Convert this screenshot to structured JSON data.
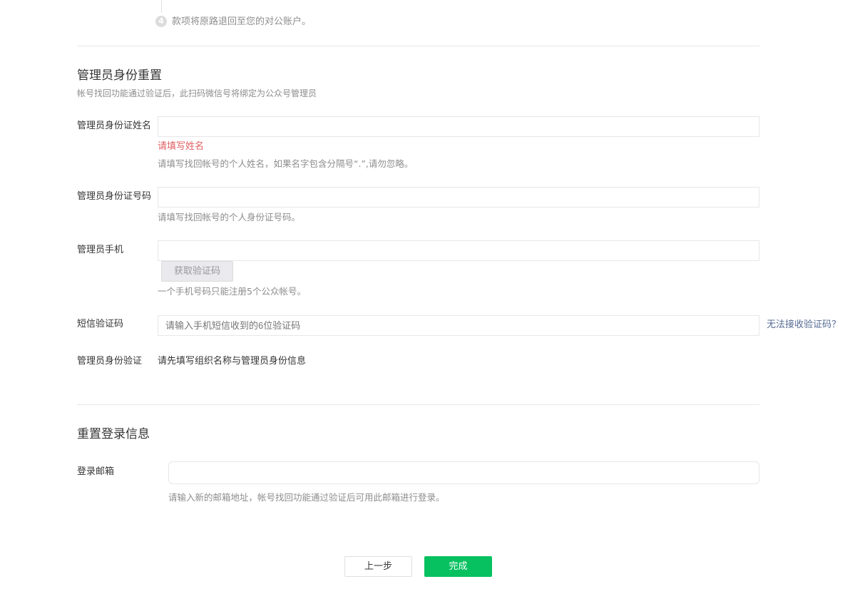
{
  "step": {
    "number": "4",
    "text": "款项将原路退回至您的对公账户。"
  },
  "admin_reset": {
    "title": "管理员身份重置",
    "subtitle": "帐号找回功能通过验证后，此扫码微信号将绑定为公众号管理员",
    "name": {
      "label": "管理员身份证姓名",
      "value": "",
      "error": "请填写姓名",
      "hint": "请填写找回帐号的个人姓名，如果名字包含分隔号“.”,请勿忽略。"
    },
    "id_number": {
      "label": "管理员身份证号码",
      "value": "",
      "hint": "请填写找回帐号的个人身份证号码。"
    },
    "phone": {
      "label": "管理员手机",
      "value": "",
      "get_code_button": "获取验证码",
      "hint": "一个手机号码只能注册5个公众帐号。"
    },
    "sms_code": {
      "label": "短信验证码",
      "placeholder": "请输入手机短信收到的6位验证码",
      "help_link": "无法接收验证码？"
    },
    "verify": {
      "label": "管理员身份验证",
      "value": "请先填写组织名称与管理员身份信息"
    }
  },
  "login_reset": {
    "title": "重置登录信息",
    "email": {
      "label": "登录邮箱",
      "value": "",
      "hint": "请输入新的邮箱地址，帐号找回功能通过验证后可用此邮箱进行登录。"
    }
  },
  "footer": {
    "prev_label": "上一步",
    "done_label": "完成"
  },
  "colors": {
    "primary": "#07c160",
    "error": "#e15f63",
    "link": "#576b95",
    "hint": "#8d8d8d"
  }
}
